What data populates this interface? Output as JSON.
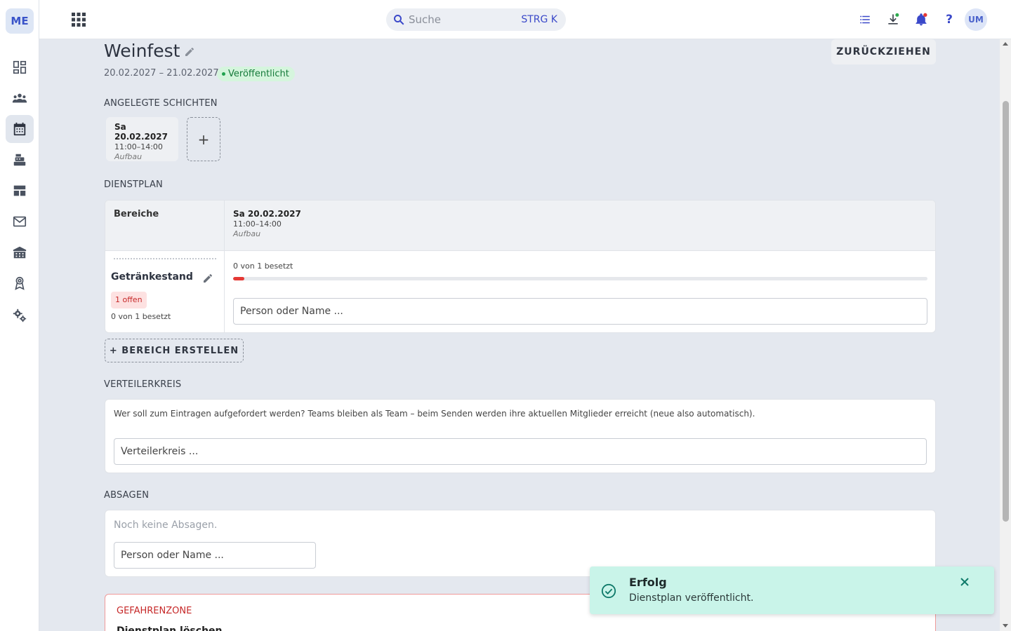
{
  "app": {
    "logo": "ME"
  },
  "sidebar": {
    "items": [
      {
        "icon": "dashboard-icon"
      },
      {
        "icon": "people-icon"
      },
      {
        "icon": "calendar-icon",
        "active": true
      },
      {
        "icon": "cash-register-icon"
      },
      {
        "icon": "table-icon"
      },
      {
        "icon": "mail-icon"
      },
      {
        "icon": "building-icon"
      },
      {
        "icon": "award-icon"
      },
      {
        "icon": "settings-icon"
      }
    ]
  },
  "topbar": {
    "search_placeholder": "Suche",
    "search_shortcut": "STRG K",
    "avatar": "UM"
  },
  "event": {
    "title": "Weinfest",
    "date_range": "20.02.2027 – 21.02.2027",
    "status": "Veröffentlicht",
    "withdraw_label": "ZURÜCKZIEHEN"
  },
  "shifts": {
    "section_label": "ANGELEGTE SCHICHTEN",
    "items": [
      {
        "date": "Sa 20.02.2027",
        "time": "11:00–14:00",
        "kind": "Aufbau"
      }
    ],
    "add_label": "+"
  },
  "plan": {
    "section_label": "DIENSTPLAN",
    "areas_header": "Bereiche",
    "column": {
      "date": "Sa 20.02.2027",
      "time": "11:00–14:00",
      "kind": "Aufbau"
    },
    "areas": [
      {
        "name": "Getränkestand",
        "open_badge": "1 offen",
        "count": "0 von 1 besetzt",
        "cell_count": "0 von 1 besetzt",
        "filled_fraction": 0.016,
        "input_placeholder": "Person oder Name ..."
      }
    ],
    "create_area_label": "+ BEREICH ERSTELLEN"
  },
  "distribution": {
    "section_label": "VERTEILERKREIS",
    "description": "Wer soll zum Eintragen aufgefordert werden? Teams bleiben als Team – beim Senden werden ihre aktuellen Mitglieder erreicht (neue also automatisch).",
    "input_placeholder": "Verteilerkreis ..."
  },
  "cancellations": {
    "section_label": "ABSAGEN",
    "empty_text": "Noch keine Absagen.",
    "input_placeholder": "Person oder Name ..."
  },
  "danger": {
    "title": "GEFAHRENZONE",
    "subtitle": "Dienstplan löschen"
  },
  "toast": {
    "title": "Erfolg",
    "message": "Dienstplan veröffentlicht."
  },
  "colors": {
    "accent": "#3a48c9",
    "success_bg": "#c9f4e9",
    "danger": "#c62828",
    "progress_fill": "#e53935"
  }
}
